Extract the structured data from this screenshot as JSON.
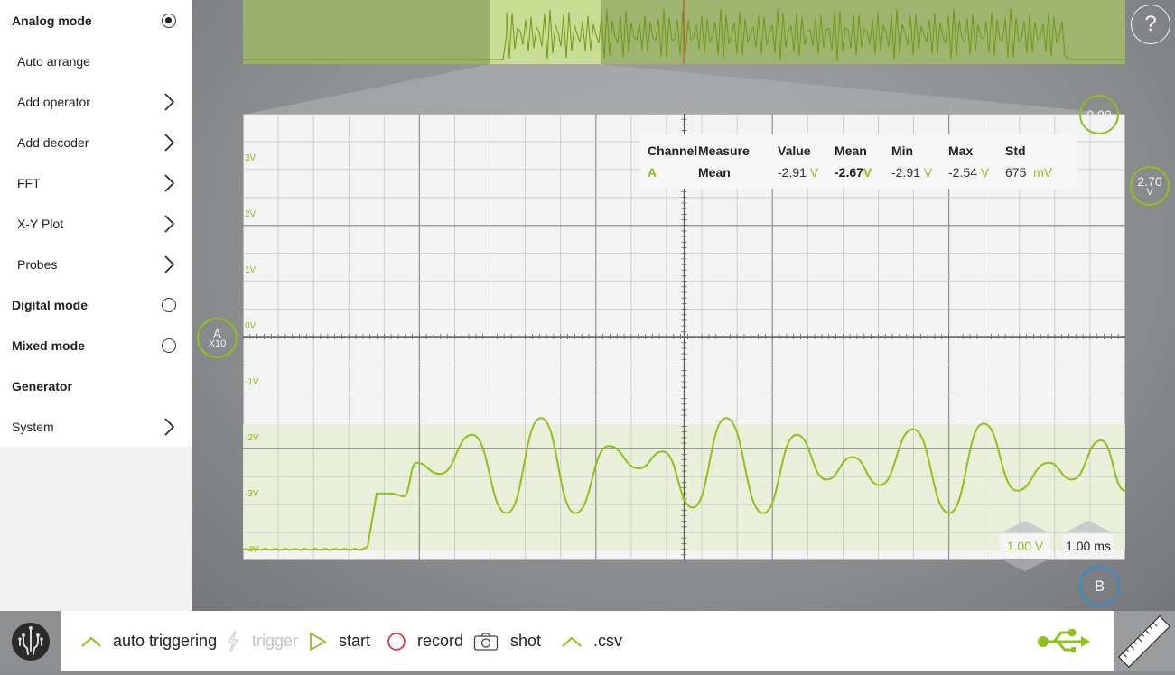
{
  "sidebar": {
    "items": [
      {
        "label": "Analog mode",
        "kind": "radio-on",
        "bold": true
      },
      {
        "label": "Auto arrange",
        "kind": "none",
        "sub": true
      },
      {
        "label": "Add operator",
        "kind": "chevron",
        "sub": true
      },
      {
        "label": "Add decoder",
        "kind": "chevron",
        "sub": true
      },
      {
        "label": "FFT",
        "kind": "chevron",
        "sub": true
      },
      {
        "label": "X-Y Plot",
        "kind": "chevron",
        "sub": true
      },
      {
        "label": "Probes",
        "kind": "chevron",
        "sub": true
      },
      {
        "label": "Digital mode",
        "kind": "radio-off",
        "bold": true
      },
      {
        "label": "Mixed mode",
        "kind": "radio-off",
        "bold": true
      },
      {
        "label": "Generator",
        "kind": "none",
        "bold": true
      },
      {
        "label": "System",
        "kind": "chevron"
      }
    ]
  },
  "toolbar": {
    "auto_triggering": "auto triggering",
    "trigger": "trigger",
    "start": "start",
    "record": "record",
    "shot": "shot",
    "csv": ".csv"
  },
  "help_label": "?",
  "offset_label": "0.00",
  "trigger_level": {
    "value": "2.70",
    "unit": "V"
  },
  "channel_a": {
    "name": "A",
    "probe": "X10"
  },
  "channel_b": {
    "name": "B"
  },
  "scale": {
    "volts_per_div": "1.00 V",
    "time_per_div": "1.00 ms"
  },
  "y_tick_labels": [
    "3V",
    "2V",
    "1V",
    "0V",
    "-1V",
    "-2V",
    "-3V",
    "-4V"
  ],
  "measurements": {
    "headers": [
      "Channel",
      "Measure",
      "Value",
      "Mean",
      "Min",
      "Max",
      "Std"
    ],
    "row": {
      "channel": "A",
      "measure": "Mean",
      "value": "-2.91",
      "value_unit": "V",
      "mean": "-2.67",
      "mean_unit": "V",
      "min": "-2.91",
      "min_unit": "V",
      "max": "-2.54",
      "max_unit": "V",
      "std": "675",
      "std_unit": "mV"
    }
  },
  "colors": {
    "accent": "#8cc21a",
    "blue": "#2f8ed6",
    "grid_bg": "#f3f3f3",
    "window_fill": "#e9efd9"
  }
}
